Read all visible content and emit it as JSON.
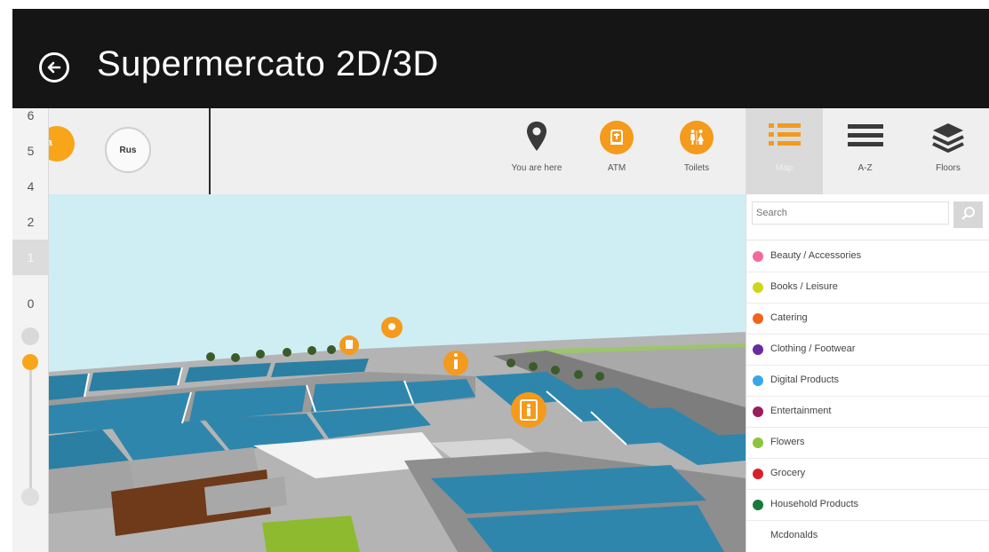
{
  "header": {
    "title": "Supermercato 2D/3D",
    "back_icon": "back-arrow-circle-icon"
  },
  "languages": [
    {
      "label": "Ita",
      "color": "#f9a51a",
      "selected": true
    },
    {
      "label": "Rus",
      "selected": false
    }
  ],
  "toolbar": {
    "you_are_here": "You are here",
    "atm": "ATM",
    "toilets": "Toilets",
    "map_tab": "Map",
    "az_tab": "A-Z",
    "floors_tab": "Floors",
    "accent_color": "#f49a1c"
  },
  "floors": {
    "items": [
      "6",
      "5",
      "4",
      "2",
      "1",
      "0"
    ],
    "current": "1"
  },
  "search": {
    "placeholder": "Search"
  },
  "categories": [
    {
      "label": "Beauty / Accessories",
      "color": "#f06b9e"
    },
    {
      "label": "Books / Leisure",
      "color": "#c9d81c"
    },
    {
      "label": "Catering",
      "color": "#f0641e"
    },
    {
      "label": "Clothing / Footwear",
      "color": "#6a2aa3"
    },
    {
      "label": "Digital Products",
      "color": "#3aa6ea"
    },
    {
      "label": "Entertainment",
      "color": "#9c1c5e"
    },
    {
      "label": "Flowers",
      "color": "#8cc43a"
    },
    {
      "label": "Grocery",
      "color": "#d8202a"
    },
    {
      "label": "Household Products",
      "color": "#157a3c"
    },
    {
      "label": "Mcdonalds",
      "color": ""
    }
  ]
}
